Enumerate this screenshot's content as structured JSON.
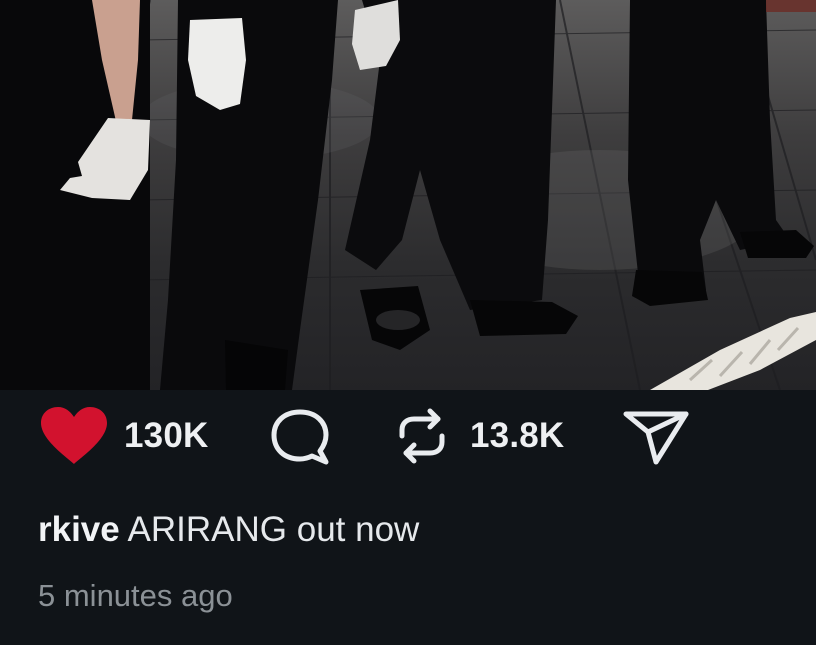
{
  "post": {
    "image_alt": "Photo of performers in black suits and white gloves on a wooden floor",
    "likes": "130K",
    "reposts": "13.8K",
    "username": "rkive",
    "caption": "ARIRANG out now",
    "timestamp": "5 minutes ago"
  },
  "icons": {
    "like": "heart-icon",
    "comment": "comment-bubble-icon",
    "repost": "repost-arrows-icon",
    "share": "send-paper-plane-icon"
  },
  "colors": {
    "background": "#101418",
    "like_active": "#d2122e",
    "text_primary": "#eef0f2",
    "text_secondary": "#8b9196"
  }
}
